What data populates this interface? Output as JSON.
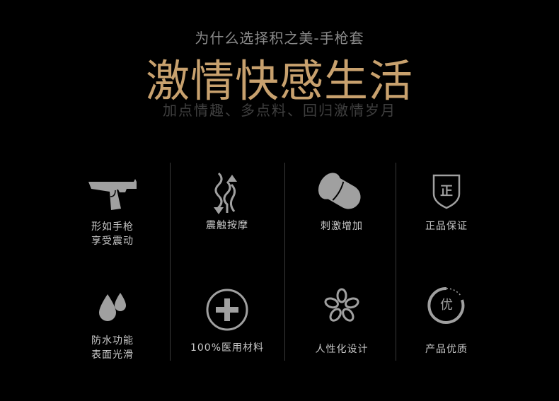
{
  "header": {
    "subtitle": "为什么选择积之美-手枪套",
    "title": "激情快感生活",
    "tagline": "加点情趣、多点料、回归激情岁月"
  },
  "features": [
    {
      "icon": "pistol-icon",
      "line1": "形如手枪",
      "line2": "享受震动"
    },
    {
      "icon": "vibration-icon",
      "line1": "震触按摩",
      "line2": ""
    },
    {
      "icon": "sleeve-icon",
      "line1": "刺激增加",
      "line2": ""
    },
    {
      "icon": "shield-badge-icon",
      "badge_text": "正",
      "line1": "正品保证",
      "line2": ""
    },
    {
      "icon": "water-drops-icon",
      "line1": "防水功能",
      "line2": "表面光滑"
    },
    {
      "icon": "medical-cross-icon",
      "line1": "100%医用材料",
      "line2": ""
    },
    {
      "icon": "flower-icon",
      "line1": "人性化设计",
      "line2": ""
    },
    {
      "icon": "quality-seal-icon",
      "badge_text": "优",
      "line1": "产品优质",
      "line2": ""
    }
  ],
  "colors": {
    "background": "#000000",
    "title": "#c8a16e",
    "icon": "#9a9a9a",
    "label": "#c9c9c9"
  }
}
